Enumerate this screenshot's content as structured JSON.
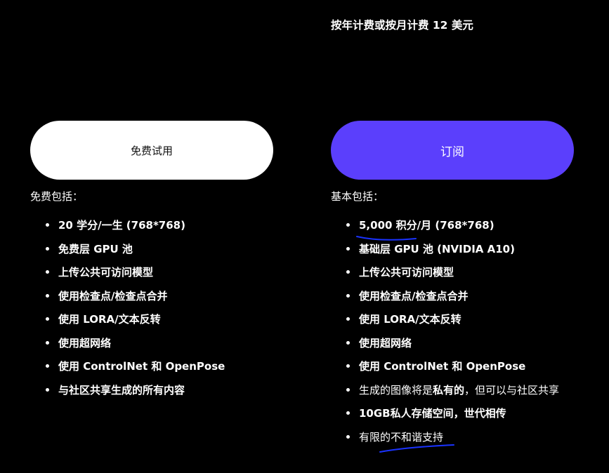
{
  "billing_note": "按年计费或按月计费 12 美元",
  "free_plan": {
    "button_label": "免费试用",
    "includes_label": "免费包括：",
    "features": [
      "20 学分/一生 (768*768)",
      "免费层 GPU 池",
      "上传公共可访问模型",
      "使用检查点/检查点合并",
      "使用 LORA/文本反转",
      "使用超网络",
      "使用 ControlNet 和 OpenPose",
      "与社区共享生成的所有内容"
    ]
  },
  "basic_plan": {
    "button_label": "订阅",
    "includes_label": "基本包括：",
    "features": [
      "5,000 积分/月 (768*768)",
      "基础层 GPU 池 (NVIDIA A10)",
      "上传公共可访问模型",
      "使用检查点/检查点合并",
      "使用 LORA/文本反转",
      "使用超网络",
      "使用 ControlNet 和 OpenPose"
    ],
    "private_feature": {
      "prefix": "生成的图像将是",
      "emphasis": "私有的",
      "suffix": "，但可以与社区共享"
    },
    "storage_feature": "10GB私人存储空间，世代相传",
    "support_feature": "有限的不和谐支持"
  },
  "colors": {
    "background": "#000000",
    "accent": "#5b3ffc",
    "annotation": "#1a33ff"
  }
}
